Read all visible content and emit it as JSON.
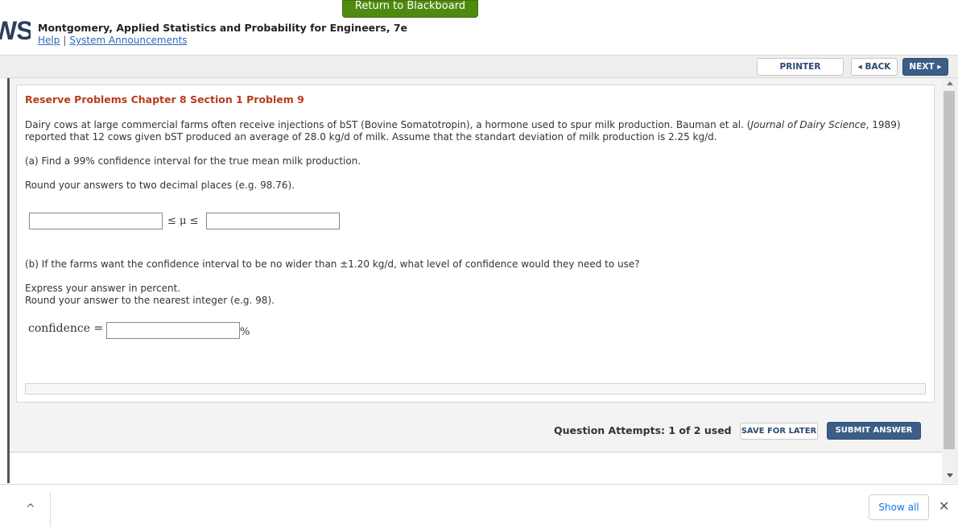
{
  "header": {
    "return_button": "Return to Blackboard",
    "logo_text": "WS",
    "book_title": "Montgomery, Applied Statistics and Probability for Engineers, 7e",
    "help_link": "Help",
    "separator": "|",
    "announcements_link": "System Announcements"
  },
  "toolbar": {
    "printer_label": "PRINTER VERSION",
    "back_label": "◂ BACK",
    "next_label": "NEXT ▸"
  },
  "question": {
    "title": "Reserve Problems Chapter 8 Section 1 Problem 9",
    "intro_part1": "Dairy cows at large commercial farms often receive injections of bST (Bovine Somatotropin), a hormone used to spur milk production. Bauman et al. (",
    "intro_journal": "Journal of Dairy Science",
    "intro_part2": ", 1989)",
    "intro_line2": "reported that 12 cows given bST produced an average of 28.0 kg/d of milk. Assume that the standart deviation of milk production is 2.25 kg/d.",
    "part_a": "(a) Find a 99% confidence interval for the true mean milk production.",
    "part_a_round": "Round your answers to two decimal places (e.g. 98.76).",
    "interval_symbol": "≤ μ ≤",
    "lower_value": "",
    "upper_value": "",
    "part_b": "(b) If the farms want the confidence interval to be no wider than ±1.20 kg/d, what level of confidence would they need to use?",
    "part_b_express": "Express your answer in percent.",
    "part_b_round": "Round your answer to the nearest integer (e.g. 98).",
    "confidence_label": "confidence =",
    "confidence_value": "",
    "percent_sign": "%"
  },
  "footer": {
    "attempts": "Question Attempts: 1 of 2 used",
    "save_label": "SAVE FOR LATER",
    "submit_label": "SUBMIT ANSWER"
  },
  "download_bar": {
    "show_all_label": "Show all",
    "close_glyph": "✕",
    "expand_glyph": "^"
  },
  "colors": {
    "return_green": "#4f8a10",
    "title_red": "#b73b1d",
    "primary_blue": "#3b5e86"
  }
}
